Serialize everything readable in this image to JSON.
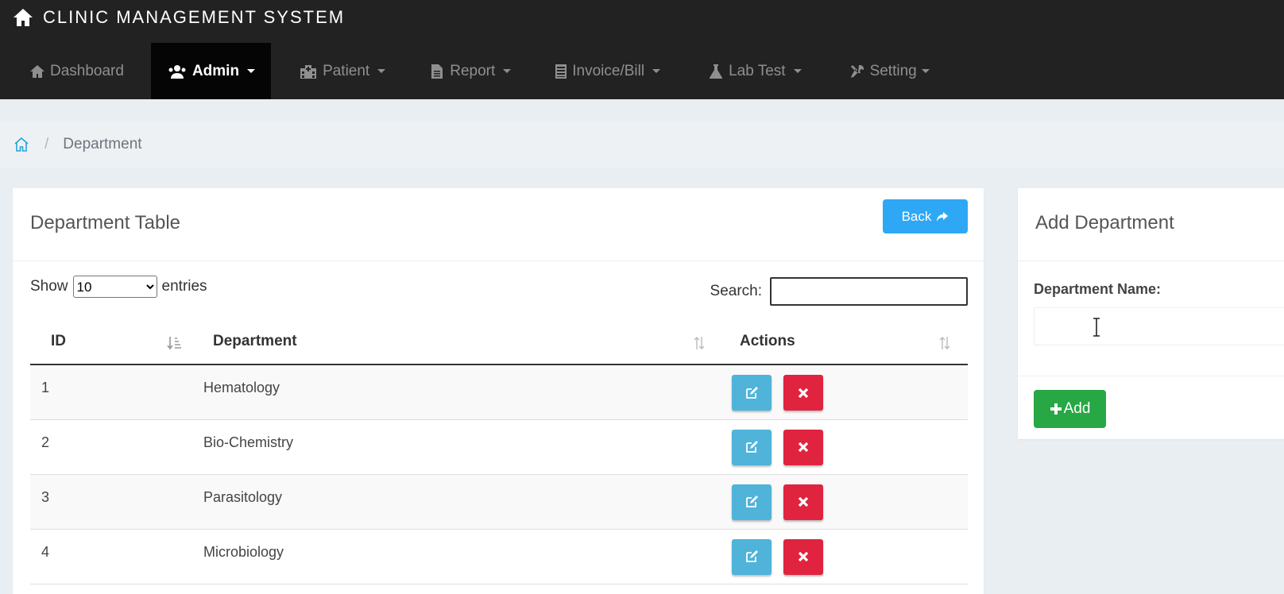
{
  "app": {
    "title": "CLINIC MANAGEMENT SYSTEM"
  },
  "nav": {
    "items": [
      {
        "label": "Dashboard",
        "icon": "home-icon",
        "dropdown": false,
        "active": false
      },
      {
        "label": "Admin",
        "icon": "users-icon",
        "dropdown": true,
        "active": true
      },
      {
        "label": "Patient",
        "icon": "hospital-icon",
        "dropdown": true,
        "active": false
      },
      {
        "label": "Report",
        "icon": "document-icon",
        "dropdown": true,
        "active": false
      },
      {
        "label": "Invoice/Bill",
        "icon": "list-icon",
        "dropdown": true,
        "active": false
      },
      {
        "label": "Lab Test",
        "icon": "flask-icon",
        "dropdown": true,
        "active": false
      },
      {
        "label": "Setting",
        "icon": "wrench-icon",
        "dropdown": true,
        "active": false
      }
    ]
  },
  "breadcrumb": {
    "current": "Department"
  },
  "table_card": {
    "title": "Department Table",
    "back_label": "Back",
    "show_label": "Show",
    "entries_label": "entries",
    "page_size": "10",
    "search_label": "Search:",
    "search_value": "",
    "columns": [
      "ID",
      "Department",
      "Actions"
    ],
    "rows": [
      {
        "id": "1",
        "department": "Hematology"
      },
      {
        "id": "2",
        "department": "Bio-Chemistry"
      },
      {
        "id": "3",
        "department": "Parasitology"
      },
      {
        "id": "4",
        "department": "Microbiology"
      }
    ]
  },
  "form_card": {
    "title": "Add Department",
    "field_label": "Department Name:",
    "field_value": "",
    "add_label": "Add"
  },
  "colors": {
    "topbar": "#222222",
    "back_button": "#2ea8f5",
    "edit_button": "#4fb3da",
    "delete_button": "#e0243f",
    "add_button": "#28a745"
  }
}
